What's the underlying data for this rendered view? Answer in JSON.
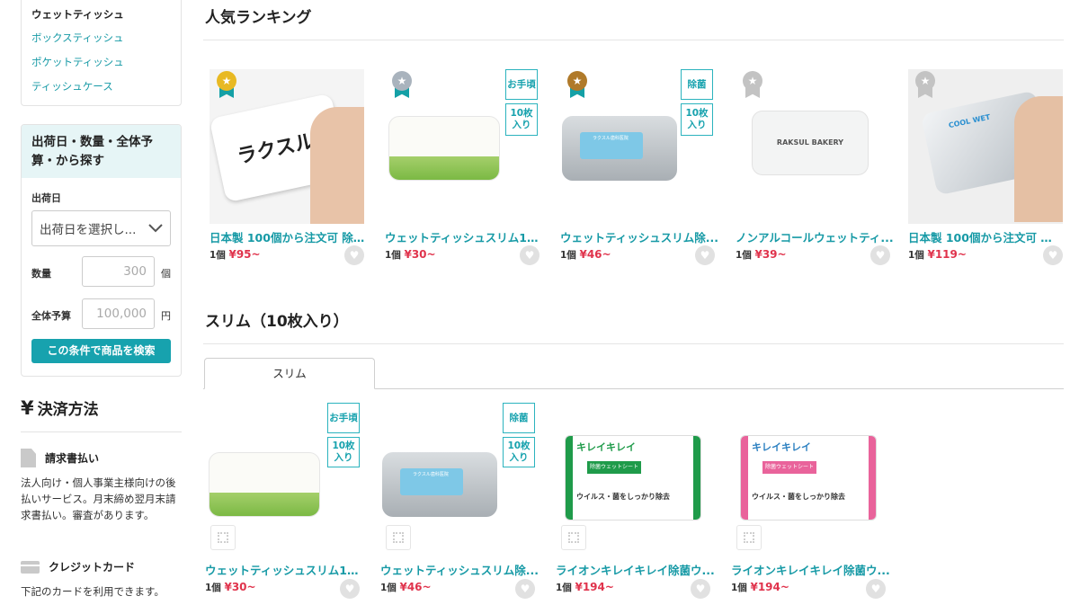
{
  "sidebar": {
    "categories": {
      "current": "ウェットティッシュ",
      "links": [
        "ボックスティッシュ",
        "ポケットティッシュ",
        "ティッシュケース"
      ]
    },
    "filter": {
      "title": "出荷日・数量・全体予算・から探す",
      "ship_label": "出荷日",
      "ship_select": "出荷日を選択し...",
      "qty_label": "数量",
      "qty_placeholder": "300",
      "qty_unit": "個",
      "budget_label": "全体予算",
      "budget_placeholder": "100,000",
      "budget_unit": "円",
      "search_button": "この条件で商品を検索"
    },
    "payment": {
      "yen_symbol": "¥",
      "title": "決済方法",
      "invoice_title": "請求書払い",
      "invoice_desc": "法人向け・個人事業主様向けの後払いサービス。月末締め翌月末請求書払い。審査があります。",
      "card_title": "クレジットカード",
      "card_desc": "下記のカードを利用できます。"
    }
  },
  "ranking": {
    "title": "人気ランキング",
    "items": [
      {
        "name": "日本製 100個から注文可 除菌...",
        "qty": "1個",
        "price": "¥95~",
        "rank_color": "#e8b923"
      },
      {
        "name": "ウェットティッシュスリム10...",
        "qty": "1個",
        "price": "¥30~",
        "rank_color": "#a9b3bd",
        "tags": [
          "お手頃",
          "10枚入り"
        ]
      },
      {
        "name": "ウェットティッシュスリム除...",
        "qty": "1個",
        "price": "¥46~",
        "rank_color": "#b07a2a",
        "tags": [
          "除菌",
          "10枚入り"
        ]
      },
      {
        "name": "ノンアルコールウェットティ...",
        "qty": "1個",
        "price": "¥39~",
        "rank_color": "#c3c3c3"
      },
      {
        "name": "日本製 100個から注文可 クー...",
        "qty": "1個",
        "price": "¥119~",
        "rank_color": "#c3c3c3"
      }
    ]
  },
  "slim": {
    "title": "スリム（10枚入り）",
    "tab": "スリム",
    "items": [
      {
        "name": "ウェットティッシュスリム10...",
        "qty": "1個",
        "price": "¥30~",
        "tags": [
          "お手頃",
          "10枚入り"
        ]
      },
      {
        "name": "ウェットティッシュスリム除...",
        "qty": "1個",
        "price": "¥46~",
        "tags": [
          "除菌",
          "10枚入り"
        ]
      },
      {
        "name": "ライオンキレイキレイ除菌ウ...",
        "qty": "1個",
        "price": "¥194~"
      },
      {
        "name": "ライオンキレイキレイ除菌ウ...",
        "qty": "1個",
        "price": "¥194~"
      }
    ]
  },
  "product_art": {
    "brand_raksul": "ラクスル",
    "raksul_bakery": "RAKSUL BAKERY",
    "kirei": "キレイキレイ",
    "kirei_sub": "除菌ウェットシート",
    "kirei_bottom": "ウイルス・菌をしっかり除去",
    "cool_wet": "COOL WET",
    "dental": "ラクスル歯科医院"
  },
  "colors": {
    "accent": "#179aa6",
    "price": "#e0334c",
    "filter_head_bg": "#e6f5f6",
    "kirei_green": "#1f9b4a",
    "kirei_pink": "#e9639b"
  }
}
